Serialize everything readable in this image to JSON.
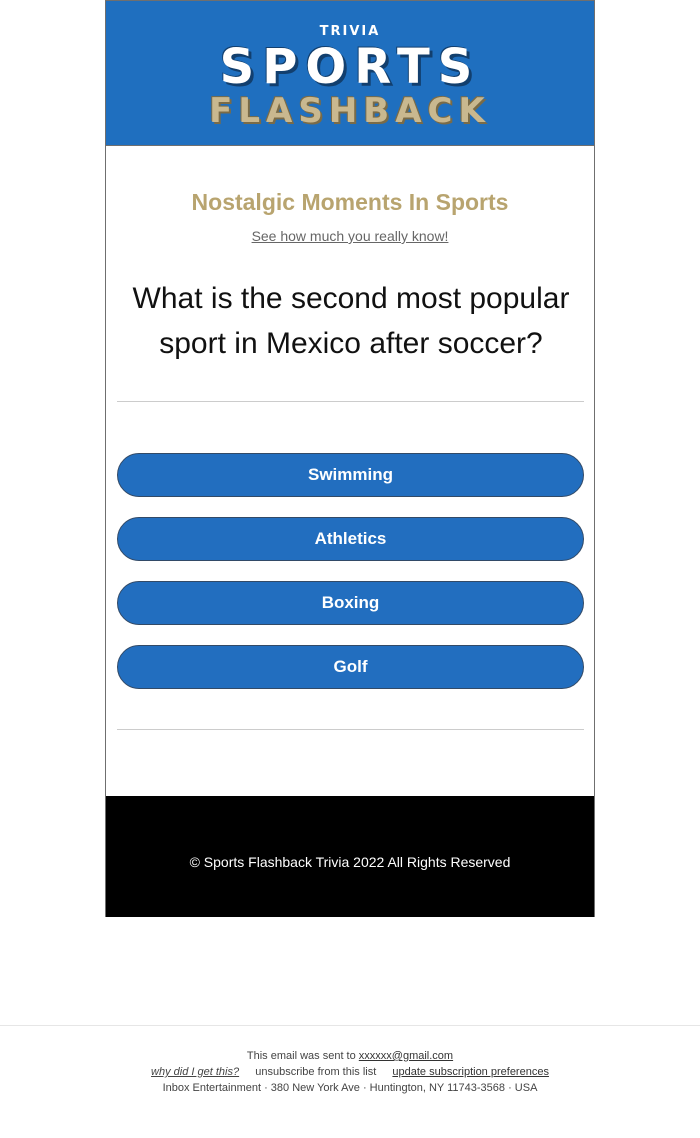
{
  "header": {
    "logo_trivia": "TRIVIA",
    "logo_sports": "SPORTS",
    "logo_flashback": "FLASHBACK"
  },
  "main": {
    "subtitle": "Nostalgic Moments In Sports",
    "tagline": "See how much you really know!",
    "question": "What is the second most popular sport in Mexico after soccer?",
    "answers": [
      "Swimming",
      "Athletics",
      "Boxing",
      "Golf"
    ]
  },
  "footer": {
    "copyright": "© Sports Flashback Trivia 2022 All Rights Reserved"
  },
  "email_footer": {
    "sent_to_prefix": "This email was sent to",
    "email": "xxxxxx@gmail.com",
    "why_link": "why did I get this?",
    "unsubscribe": "unsubscribe from this list",
    "preferences_link": "update subscription preferences",
    "address": "Inbox Entertainment · 380 New York Ave · Huntington, NY 11743-3568 · USA"
  },
  "colors": {
    "header_blue": "#1f6fbf",
    "gold": "#b8a46f",
    "button_blue": "#226ebf",
    "footer_black": "#000000"
  }
}
